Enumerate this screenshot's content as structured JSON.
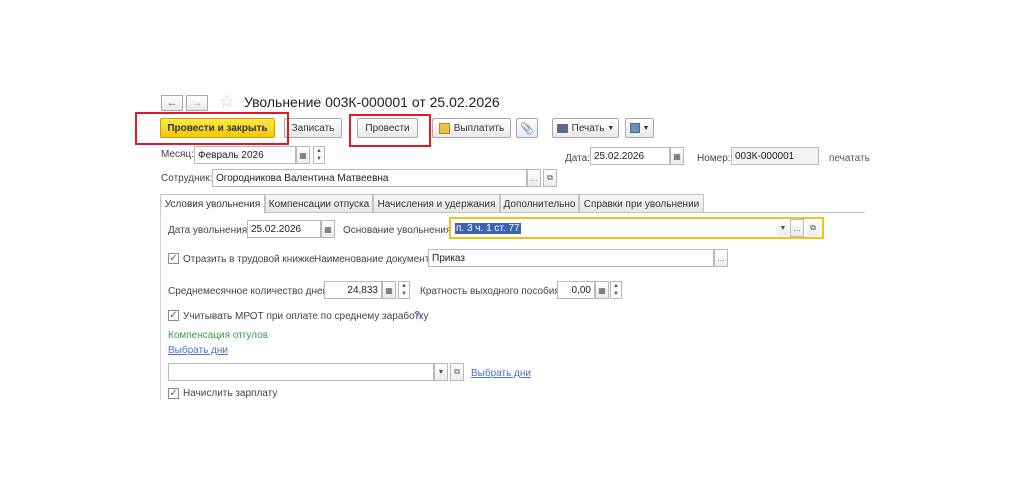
{
  "window": {
    "title": "Увольнение 003К-000001 от 25.02.2026"
  },
  "toolbar": {
    "post_close_label": "Провести и закрыть",
    "save_label": "Записать",
    "post_label": "Провести",
    "pay_label": "Выплатить",
    "print_label": "Печать"
  },
  "header": {
    "month_label": "Месяц:",
    "month_value": "Февраль 2026",
    "date_label": "Дата:",
    "date_value": "25.02.2026",
    "number_label": "Номер:",
    "number_value": "003К-000001",
    "print_link": "печатать",
    "employee_label": "Сотрудник:",
    "employee_value": "Огородникова Валентина Матвеевна"
  },
  "tabs": [
    {
      "label": "Условия увольнения"
    },
    {
      "label": "Компенсации отпуска"
    },
    {
      "label": "Начисления и удержания"
    },
    {
      "label": "Дополнительно"
    },
    {
      "label": "Справки при увольнении"
    }
  ],
  "conditions": {
    "dismissal_date_label": "Дата увольнения:",
    "dismissal_date_value": "25.02.2026",
    "basis_label": "Основание увольнения:",
    "basis_value": "п. 3 ч. 1 ст. 77",
    "reflect_label": "Отразить в трудовой книжке",
    "doc_name_label": "Наименование документа:",
    "doc_name_value": "Приказ",
    "avg_days_label": "Среднемесячное количество дней:",
    "avg_days_value": "24,833",
    "severance_label": "Кратность выходного пособия:",
    "severance_value": "0,00",
    "mrot_label": "Учитывать МРОТ при оплате по среднему заработку",
    "mrot_help": "?",
    "compensation_title": "Компенсация отгулов",
    "select_days_link": "Выбрать дни",
    "select_days_link2": "Выбрать дни",
    "accrue_salary_label": "Начислить зарплату"
  },
  "colors": {
    "primary_button": "#f5c800",
    "highlight_red": "#e0182a",
    "link": "#4a6fc3",
    "green_heading": "#3a9a4a",
    "focus_border": "#f0c419"
  }
}
